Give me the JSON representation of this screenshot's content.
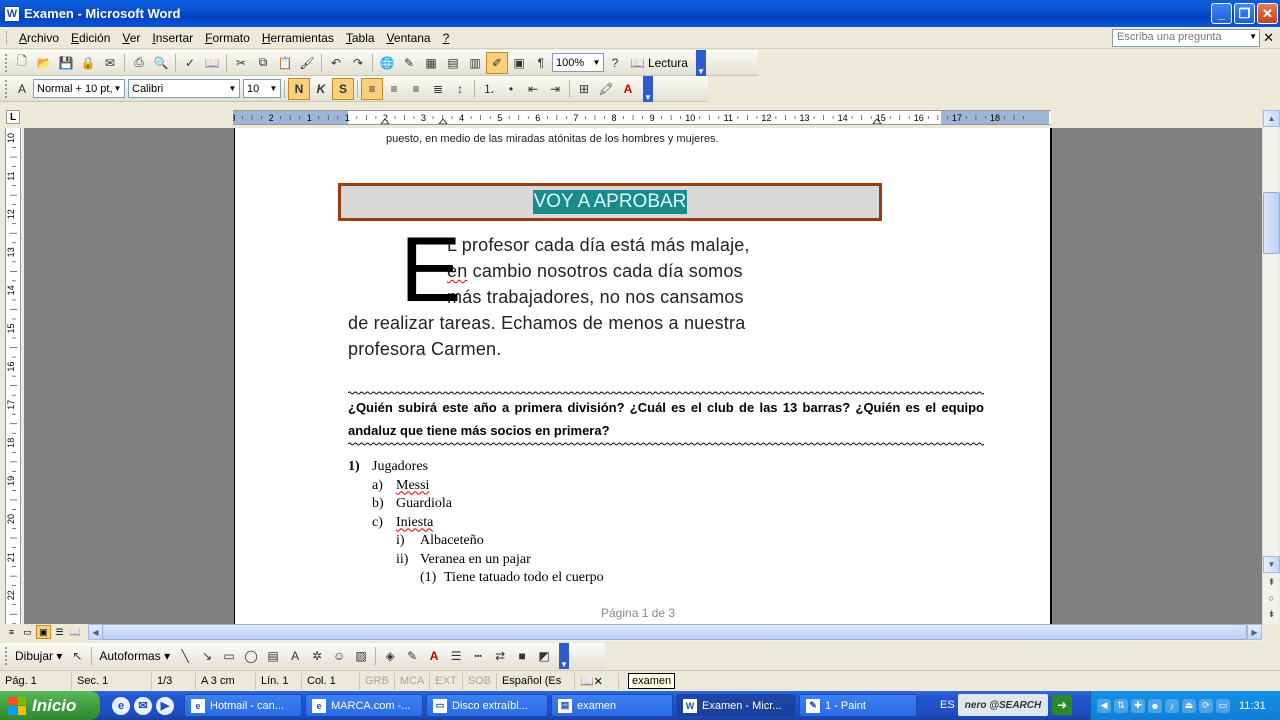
{
  "window": {
    "title": "Examen - Microsoft Word",
    "controls": {
      "minimize": "_",
      "maximize": "❐",
      "close": "✕"
    }
  },
  "menu": {
    "items": [
      {
        "label": "Archivo",
        "key": "A",
        "rest": "rchivo"
      },
      {
        "label": "Edición",
        "key": "E",
        "rest": "dición"
      },
      {
        "label": "Ver",
        "key": "V",
        "rest": "er"
      },
      {
        "label": "Insertar",
        "key": "I",
        "rest": "nsertar"
      },
      {
        "label": "Formato",
        "key": "F",
        "rest": "ormato"
      },
      {
        "label": "Herramientas",
        "key": "H",
        "rest": "erramientas"
      },
      {
        "label": "Tabla",
        "key": "T",
        "rest": "abla"
      },
      {
        "label": "Ventana",
        "key": "V",
        "rest": "entana"
      },
      {
        "label": "?",
        "key": "?",
        "rest": ""
      }
    ],
    "ask_placeholder": "Escriba una pregunta",
    "close": "✕"
  },
  "standard_toolbar": {
    "zoom": "100%",
    "reading_label": "Lectura"
  },
  "format_toolbar": {
    "style": "Normal + 10 pt,",
    "font": "Calibri",
    "size": "10",
    "bold": "N",
    "italic": "K",
    "underline": "S"
  },
  "ruler": {
    "ticks": [
      "3",
      "2",
      "1",
      "1",
      "2",
      "3",
      "4",
      "5",
      "6",
      "7",
      "8",
      "9",
      "10",
      "11",
      "12",
      "13",
      "14",
      "15",
      "16",
      "17",
      "18"
    ],
    "vticks": [
      "10",
      "11",
      "12",
      "13",
      "14",
      "15",
      "16",
      "17",
      "18",
      "19",
      "20",
      "21",
      "22"
    ]
  },
  "document": {
    "top_text": "puesto, en medio de las miradas atónitas de los hombres y mujeres.",
    "banner": "VOY  A APROBAR",
    "dropcap": "E",
    "para_lines": [
      "L profesor cada día está más malaje,",
      "en cambio nosotros cada día somos",
      "más trabajadores, no nos cansamos",
      "de realizar tareas. Echamos de menos a nuestra",
      "profesora Carmen."
    ],
    "question": "¿Quién subirá  este año a primera división? ¿Cuál es el club de las 13 barras?  ¿Quién es el equipo andaluz que tiene más socios en primera?",
    "list": [
      {
        "num": "1)",
        "text": "Jugadores",
        "level": 0
      },
      {
        "num": "a)",
        "text": "Messi",
        "level": 1
      },
      {
        "num": "b)",
        "text": "Guardiola",
        "level": 1
      },
      {
        "num": "c)",
        "text": "Iniesta",
        "level": 1
      },
      {
        "num": "i)",
        "text": "Albaceteño",
        "level": 2
      },
      {
        "num": "ii)",
        "text": "Veranea en un pajar",
        "level": 2
      },
      {
        "num": "(1)",
        "text": "Tiene tatuado todo el cuerpo",
        "level": 3
      }
    ],
    "footer": "Página 1 de 3"
  },
  "drawing_toolbar": {
    "draw_label": "Dibujar",
    "autoshapes_label": "Autoformas"
  },
  "status": {
    "page": "Pág. 1",
    "section": "Sec. 1",
    "pages": "1/3",
    "at": "A  3 cm",
    "line": "Lín. 1",
    "col": "Col. 1",
    "grb": "GRB",
    "mca": "MCA",
    "ext": "EXT",
    "sob": "SOB",
    "language": "Español (Es",
    "tooltip": "examen"
  },
  "taskbar": {
    "start": "Inicio",
    "tasks": [
      {
        "label": "Hotmail - can...",
        "icon": "e"
      },
      {
        "label": "MARCA.com -...",
        "icon": "e"
      },
      {
        "label": "Disco extraíbl...",
        "icon": "▭"
      },
      {
        "label": "examen",
        "icon": "▤"
      },
      {
        "label": "Examen - Micr...",
        "icon": "W"
      },
      {
        "label": "1 - Paint",
        "icon": "✎"
      }
    ],
    "lang": "ES",
    "nero": "nero @SEARCH",
    "clock": "11:31"
  }
}
